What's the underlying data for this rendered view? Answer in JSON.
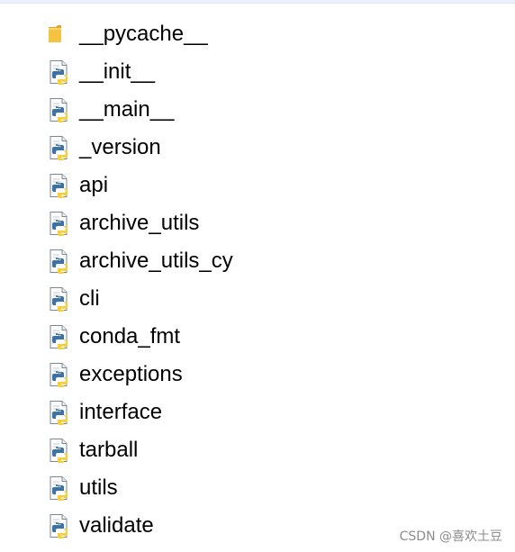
{
  "colors": {
    "folder": "#f5c342",
    "python_blue": "#3b73a8",
    "python_yellow": "#f6cf3c",
    "page": "#ffffff",
    "page_border": "#7b8794"
  },
  "files": [
    {
      "name": "__pycache__",
      "type": "folder",
      "icon": "folder-icon"
    },
    {
      "name": "__init__",
      "type": "python",
      "icon": "python-file-icon"
    },
    {
      "name": "__main__",
      "type": "python",
      "icon": "python-file-icon"
    },
    {
      "name": "_version",
      "type": "python",
      "icon": "python-file-icon"
    },
    {
      "name": "api",
      "type": "python",
      "icon": "python-file-icon"
    },
    {
      "name": "archive_utils",
      "type": "python",
      "icon": "python-file-icon"
    },
    {
      "name": "archive_utils_cy",
      "type": "python",
      "icon": "python-file-icon"
    },
    {
      "name": "cli",
      "type": "python",
      "icon": "python-file-icon"
    },
    {
      "name": "conda_fmt",
      "type": "python",
      "icon": "python-file-icon"
    },
    {
      "name": "exceptions",
      "type": "python",
      "icon": "python-file-icon"
    },
    {
      "name": "interface",
      "type": "python",
      "icon": "python-file-icon"
    },
    {
      "name": "tarball",
      "type": "python",
      "icon": "python-file-icon"
    },
    {
      "name": "utils",
      "type": "python",
      "icon": "python-file-icon"
    },
    {
      "name": "validate",
      "type": "python",
      "icon": "python-file-icon"
    }
  ],
  "watermark": "CSDN @喜欢土豆"
}
